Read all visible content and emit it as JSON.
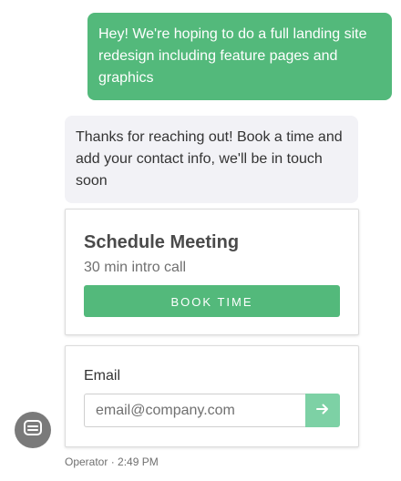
{
  "messages": {
    "user_text": "Hey! We're hoping to do a full landing site redesign including feature pages and graphics",
    "operator_text": "Thanks for reaching out! Book a time and add your contact info, we'll be in touch soon"
  },
  "meeting_card": {
    "title": "Schedule Meeting",
    "subtitle": "30 min intro call",
    "button_label": "BOOK TIME"
  },
  "email_card": {
    "label": "Email",
    "placeholder": "email@company.com",
    "value": "",
    "submit_icon": "arrow-right-icon"
  },
  "operator": {
    "avatar_icon": "chat-bubble-icon",
    "meta": "Operator · 2:49 PM"
  },
  "colors": {
    "accent": "#53b97b",
    "submit": "#7dd1a5",
    "operator_bubble": "#f2f2f6",
    "avatar": "#7a7a7a"
  }
}
